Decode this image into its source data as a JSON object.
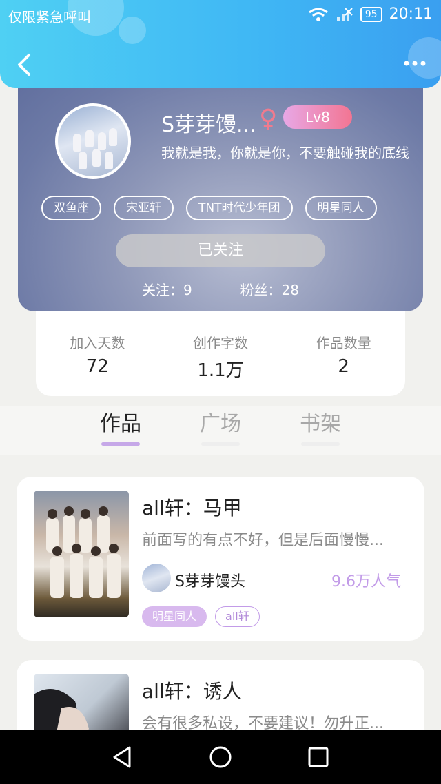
{
  "status_bar": {
    "carrier": "仅限紧急呼叫",
    "battery": "95",
    "time": "20:11"
  },
  "header": {
    "back_icon": "chevron-left-icon",
    "more_icon": "more-horizontal-icon"
  },
  "profile": {
    "name": "S芽芽馒...",
    "gender_icon": "female-icon",
    "level": "Lv8",
    "bio": "我就是我，你就是你，不要触碰我的底线",
    "tags": [
      "双鱼座",
      "宋亚轩",
      "TNT时代少年团",
      "明星同人"
    ],
    "follow_label": "已关注",
    "following_label": "关注：9",
    "followers_label": "粉丝：28"
  },
  "stats": [
    {
      "label": "加入天数",
      "value": "72"
    },
    {
      "label": "创作字数",
      "value": "1.1万"
    },
    {
      "label": "作品数量",
      "value": "2"
    }
  ],
  "tabs": [
    {
      "label": "作品",
      "active": true
    },
    {
      "label": "广场",
      "active": false
    },
    {
      "label": "书架",
      "active": false
    }
  ],
  "works": [
    {
      "title": "all轩：马甲",
      "desc": "前面写的有点不好，但是后面慢慢...",
      "author": "S芽芽馒头",
      "popularity": "9.6万人气",
      "tags": [
        "明星同人",
        "all轩"
      ]
    },
    {
      "title": "all轩：诱人",
      "desc": "会有很多私设，不要建议！勿升正...",
      "author": "",
      "popularity": "",
      "tags": []
    }
  ],
  "navbar": {
    "back_icon": "nav-back-icon",
    "home_icon": "nav-home-icon",
    "recents_icon": "nav-recents-icon"
  },
  "colors": {
    "header_blue": "#3fb6f4",
    "accent_purple": "#c29be8",
    "level_pink": "#f27592"
  }
}
